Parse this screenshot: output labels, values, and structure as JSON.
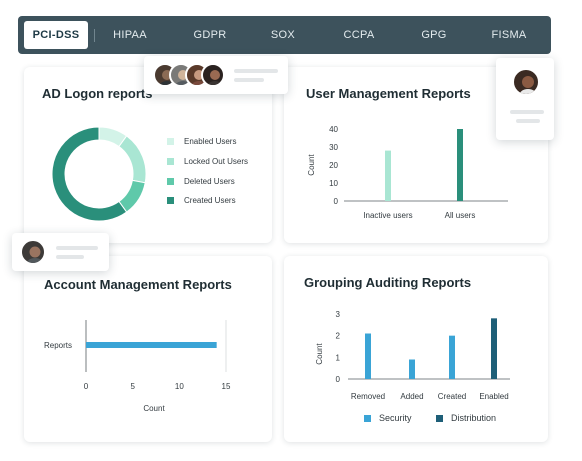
{
  "tabs": [
    "PCI-DSS",
    "HIPAA",
    "GDPR",
    "SOX",
    "CCPA",
    "GPG",
    "FISMA"
  ],
  "active_tab": "PCI-DSS",
  "colors": {
    "tab_bar": "#3d525c",
    "teal_dark": "#2a8f7b",
    "teal_mid": "#5fc9aa",
    "teal_light": "#a9e6d3",
    "teal_pale": "#d3f3e8",
    "security": "#3aa4d6",
    "distribution": "#1e5f78",
    "hbar": "#3aa4d6"
  },
  "cards": {
    "ad_logon": {
      "title": "AD Logon reports",
      "chart_data": {
        "type": "pie",
        "labels": [
          "Enabled Users",
          "Locked Out Users",
          "Deleted Users",
          "Created Users"
        ],
        "values": [
          10,
          18,
          12,
          60
        ],
        "colors": [
          "#d3f3e8",
          "#a9e6d3",
          "#5fc9aa",
          "#2a8f7b"
        ]
      }
    },
    "user_management": {
      "title": "User Management Reports",
      "chart_data": {
        "type": "bar",
        "categories": [
          "Inactive users",
          "All users"
        ],
        "values": [
          28,
          40
        ],
        "ylabel": "Count",
        "ylim": [
          0,
          40
        ],
        "yticks": [
          0,
          10,
          20,
          30,
          40
        ],
        "colors": [
          "#a9e6d3",
          "#2a8f7b"
        ]
      }
    },
    "account_management": {
      "title": "Account Management Reports",
      "chart_data": {
        "type": "bar",
        "orientation": "horizontal",
        "categories": [
          "Reports"
        ],
        "values": [
          14
        ],
        "xlabel": "Count",
        "xlim": [
          0,
          15
        ],
        "xticks": [
          0,
          5,
          10,
          15
        ]
      }
    },
    "grouping_auditing": {
      "title": "Grouping Auditing Reports",
      "chart_data": {
        "type": "bar",
        "categories": [
          "Removed",
          "Added",
          "Created",
          "Enabled"
        ],
        "series": [
          {
            "name": "Security",
            "values": [
              2.1,
              0.9,
              2.0,
              null
            ]
          },
          {
            "name": "Distribution",
            "values": [
              null,
              null,
              null,
              2.8
            ]
          }
        ],
        "ylabel": "Count",
        "ylim": [
          0,
          3
        ],
        "yticks": [
          0,
          1,
          2,
          3
        ]
      }
    }
  },
  "legend_bottom": [
    "Security",
    "Distribution"
  ]
}
